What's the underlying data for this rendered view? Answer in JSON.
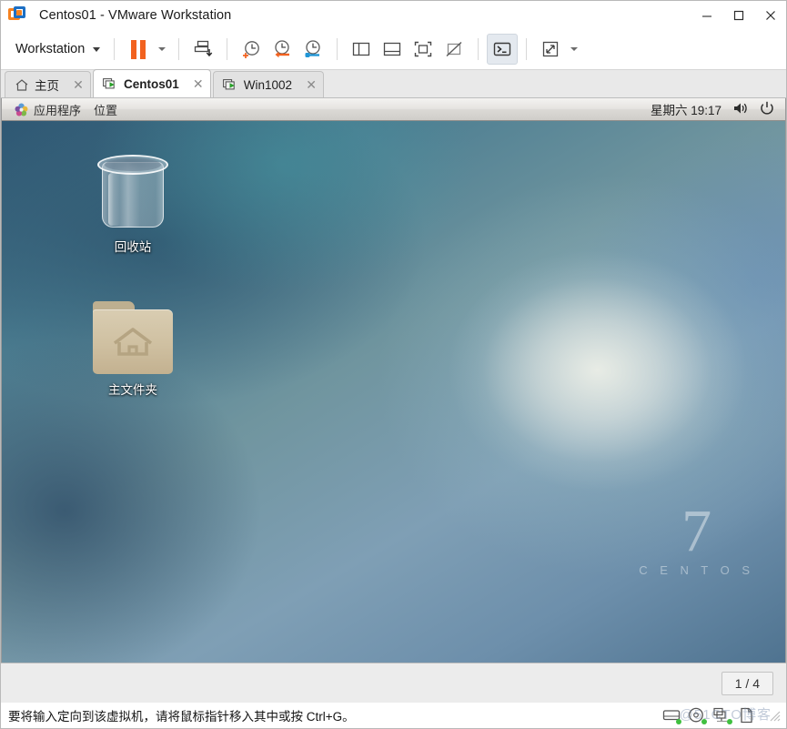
{
  "window": {
    "title": "Centos01 - VMware Workstation",
    "logo_icon": "vmware-logo-icon",
    "minimize_label": "–",
    "maximize_label": "☐",
    "close_label": "✕"
  },
  "toolbar": {
    "workstation_label": "Workstation",
    "items": [
      {
        "name": "pause-vm-button",
        "icon": "pause-icon"
      },
      {
        "name": "pause-dropdown-button",
        "icon": "chevron-down-icon"
      },
      {
        "name": "send-ctrl-alt-del-button",
        "icon": "send-keys-icon"
      },
      {
        "name": "take-snapshot-button",
        "icon": "snapshot-add-icon"
      },
      {
        "name": "revert-snapshot-button",
        "icon": "snapshot-revert-icon"
      },
      {
        "name": "snapshot-manager-button",
        "icon": "snapshot-manager-icon"
      },
      {
        "name": "show-sidebar-button",
        "icon": "sidebar-panel-icon"
      },
      {
        "name": "show-thumbnail-bar-button",
        "icon": "bottom-panel-icon"
      },
      {
        "name": "fit-guest-now-button",
        "icon": "fit-window-icon"
      },
      {
        "name": "stretch-guest-button",
        "icon": "no-stretch-icon"
      },
      {
        "name": "console-view-button",
        "icon": "terminal-icon"
      },
      {
        "name": "fullscreen-button",
        "icon": "fullscreen-expand-icon"
      },
      {
        "name": "fullscreen-dropdown-button",
        "icon": "chevron-down-icon"
      }
    ]
  },
  "tabs": [
    {
      "label": "主页",
      "icon": "home-icon",
      "active": false,
      "close": "✕"
    },
    {
      "label": "Centos01",
      "icon": "vm-running-icon",
      "active": true,
      "close": "✕"
    },
    {
      "label": "Win1002",
      "icon": "vm-running-icon",
      "active": false,
      "close": "✕"
    }
  ],
  "guest": {
    "panel": {
      "applications_label": "应用程序",
      "applications_icon": "pinwheel-icon",
      "places_label": "位置",
      "clock": "星期六 19:17",
      "volume_icon": "volume-icon",
      "power_icon": "power-icon"
    },
    "desktop_icons": [
      {
        "name": "desktop-icon-trash",
        "label": "回收站",
        "icon": "trash-icon"
      },
      {
        "name": "desktop-icon-home-folder",
        "label": "主文件夹",
        "icon": "home-folder-icon"
      }
    ],
    "watermark": {
      "number": "7",
      "text": "C E N T O S"
    }
  },
  "bottom": {
    "workspace_indicator": "1 / 4"
  },
  "statusbar": {
    "message": "要将输入定向到该虚拟机，请将鼠标指针移入其中或按 Ctrl+G。",
    "watermark": "@51CTO博客",
    "devices": [
      {
        "name": "status-hard-disk-icon",
        "icon": "hard-disk-icon"
      },
      {
        "name": "status-cd-dvd-icon",
        "icon": "cd-dvd-icon"
      },
      {
        "name": "status-network-icon",
        "icon": "network-icon"
      },
      {
        "name": "status-printer-icon",
        "icon": "printer-icon"
      }
    ]
  },
  "colors": {
    "vmware_orange": "#f2621f",
    "vmware_blue": "#1c6fc4",
    "status_green": "#3fbf3f",
    "panel_bg": "#e9e9e9"
  }
}
